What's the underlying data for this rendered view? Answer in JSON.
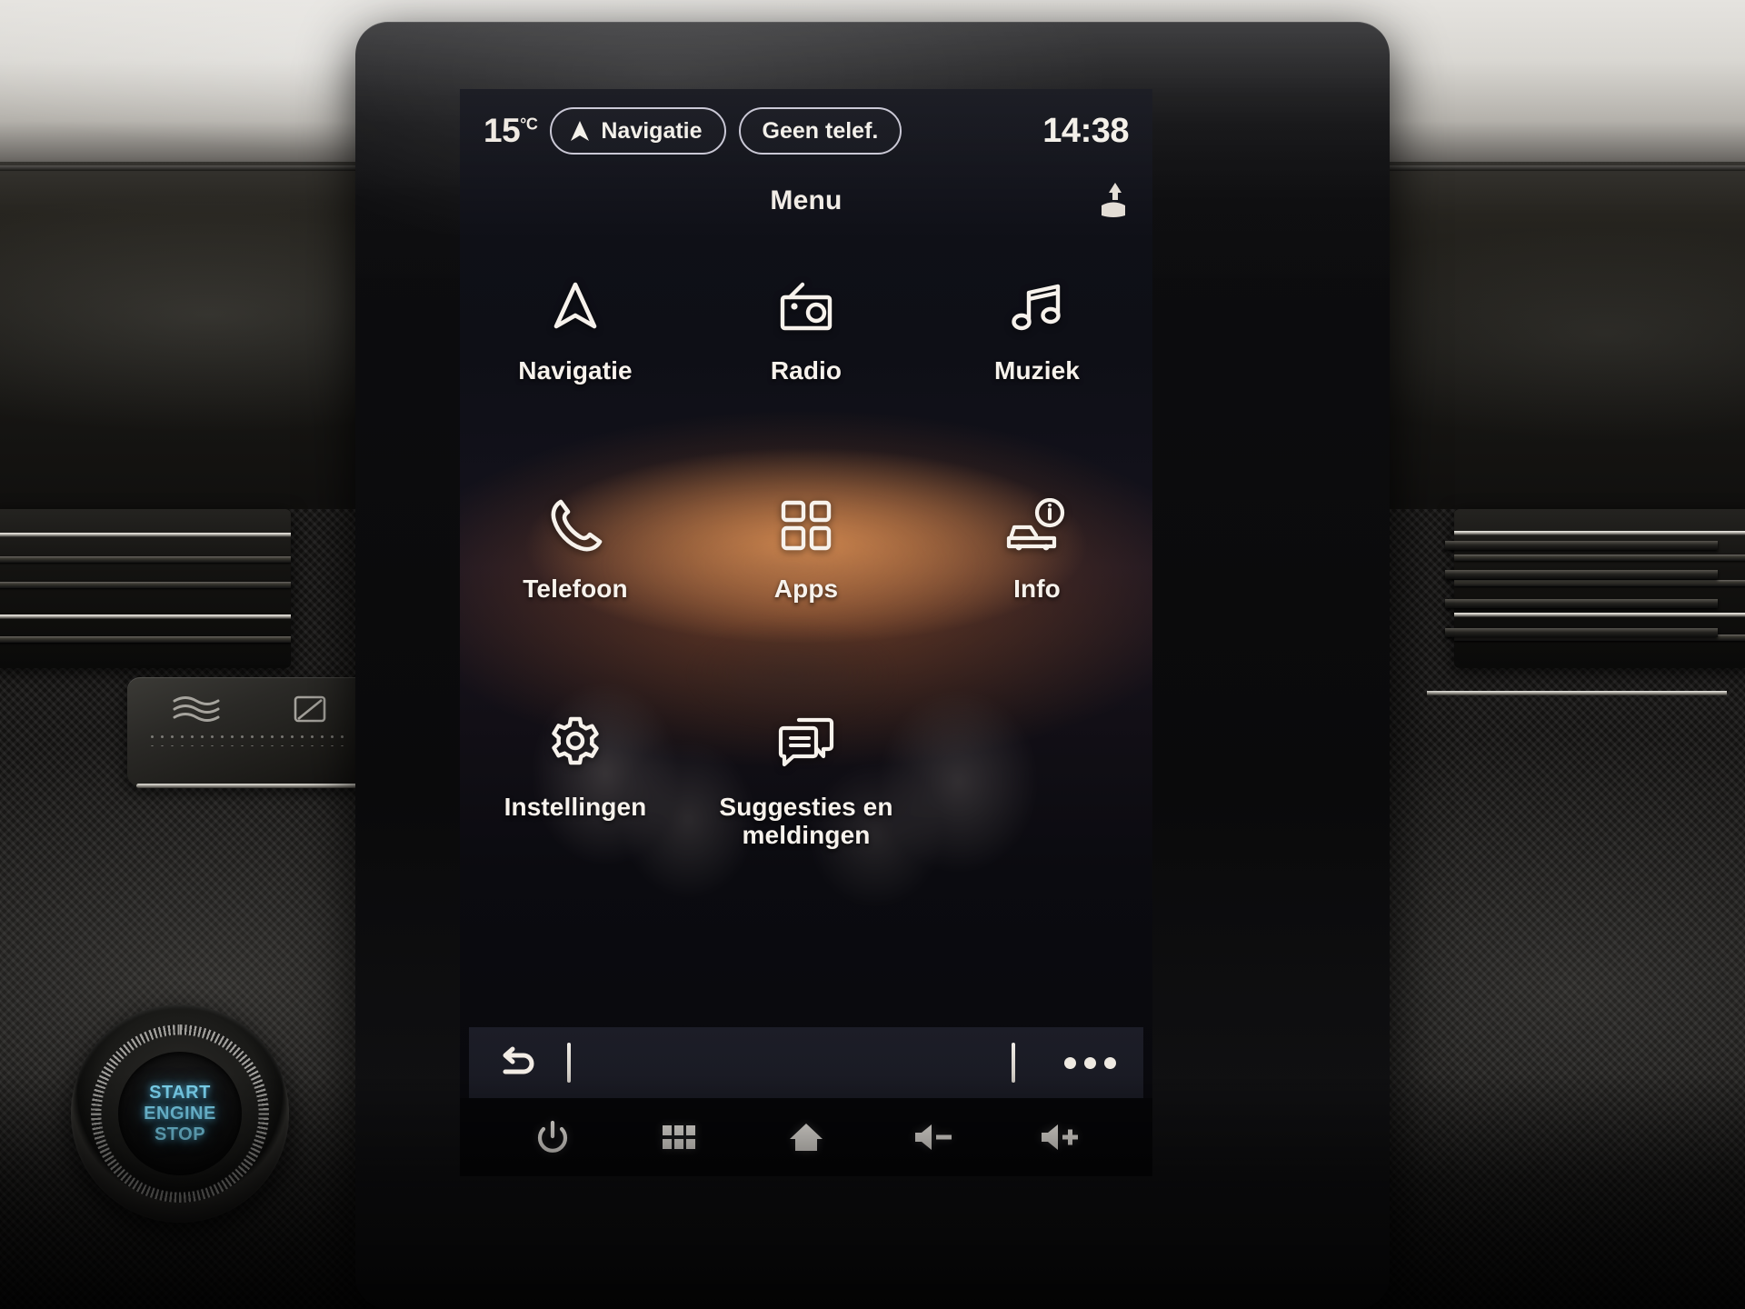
{
  "vehicle": {
    "start_button": {
      "line1": "START",
      "line2": "ENGINE",
      "line3": "STOP"
    },
    "vent_left": {
      "airflow_icon": "airflow-wave-icon",
      "closed_vent_icon": "vent-closed-icon"
    }
  },
  "screen": {
    "statusbar": {
      "temperature": "15",
      "temperature_unit": "°C",
      "nav_pill": {
        "label": "Navigatie",
        "icon": "navigation-arrow-icon"
      },
      "phone_pill": {
        "label": "Geen telef."
      },
      "clock": "14:38"
    },
    "header": {
      "title": "Menu",
      "right_icon": "seat-heating-icon"
    },
    "menu_items": [
      {
        "label": "Navigatie",
        "icon": "navigation-arrow-icon"
      },
      {
        "label": "Radio",
        "icon": "radio-icon"
      },
      {
        "label": "Muziek",
        "icon": "music-note-icon"
      },
      {
        "label": "Telefoon",
        "icon": "phone-handset-icon"
      },
      {
        "label": "Apps",
        "icon": "apps-grid-icon"
      },
      {
        "label": "Info",
        "icon": "car-info-icon"
      },
      {
        "label": "Instellingen",
        "icon": "gear-icon"
      },
      {
        "label": "Suggesties en meldingen",
        "icon": "message-bubbles-icon"
      }
    ],
    "context_bar": {
      "back_icon": "back-arrow-icon",
      "more_icon": "more-dots-icon"
    },
    "hard_keys": [
      {
        "name": "power",
        "icon": "power-icon"
      },
      {
        "name": "app-grid",
        "icon": "grid-squares-icon"
      },
      {
        "name": "home",
        "icon": "home-icon"
      },
      {
        "name": "volume-down",
        "icon": "volume-down-icon"
      },
      {
        "name": "volume-up",
        "icon": "volume-up-icon"
      }
    ]
  },
  "colors": {
    "screen_bg": "#0d0e14",
    "text": "#f7f2ec",
    "pill_border": "#c8c6d4",
    "glow": "#e99654",
    "start_button_text": "#7fd9f5"
  }
}
